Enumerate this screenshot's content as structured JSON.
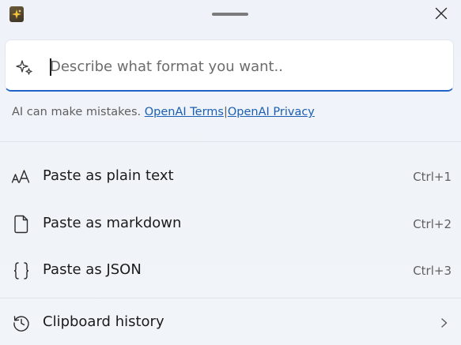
{
  "input": {
    "placeholder": "Describe what format you want.."
  },
  "disclaimer": {
    "text": "AI can make mistakes.",
    "terms_link": "OpenAI Terms",
    "separator": "|",
    "privacy_link": "OpenAI Privacy"
  },
  "menu": {
    "items": [
      {
        "label": "Paste as plain text",
        "shortcut": "Ctrl+1",
        "icon": "font-size-icon"
      },
      {
        "label": "Paste as markdown",
        "shortcut": "Ctrl+2",
        "icon": "document-icon"
      },
      {
        "label": "Paste as JSON",
        "shortcut": "Ctrl+3",
        "icon": "braces-icon"
      }
    ],
    "history": {
      "label": "Clipboard history",
      "icon": "history-icon"
    }
  },
  "colors": {
    "accent": "#1f63c6",
    "link": "#1a5fb4",
    "background": "#eef2f8"
  }
}
